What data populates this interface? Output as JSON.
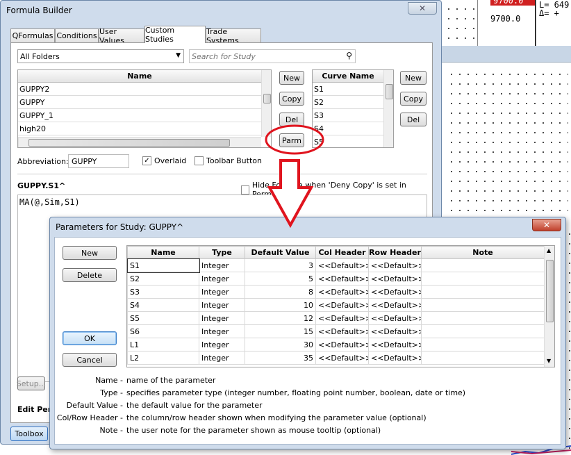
{
  "background_chart": {
    "price_top": "9700.0",
    "price_label": "9700.0",
    "stat_line1": "L= 649",
    "stat_line2": "Δ=   +"
  },
  "formula_builder": {
    "title": "Formula Builder",
    "close_icon": "✕",
    "tabs": [
      {
        "label": "QFormulas"
      },
      {
        "label": "Conditions"
      },
      {
        "label": "User Values"
      },
      {
        "label": "Custom Studies",
        "selected": true
      },
      {
        "label": "Trade Systems"
      }
    ],
    "folder_select": "All Folders",
    "search_placeholder": "Search for Study",
    "studies_header": "Name",
    "studies": [
      "GUPPY2",
      "GUPPY",
      "GUPPY_1",
      "high20"
    ],
    "study_buttons": {
      "new": "New",
      "copy": "Copy",
      "del": "Del",
      "parm": "Parm"
    },
    "curves_header": "Curve Name",
    "curves": [
      "S1",
      "S2",
      "S3",
      "S4",
      "S5"
    ],
    "curve_buttons": {
      "new": "New",
      "copy": "Copy",
      "del": "Del"
    },
    "abbreviation_label": "Abbreviation:",
    "abbreviation_value": "GUPPY",
    "overlaid_label": "Overlaid",
    "overlaid_checked": true,
    "toolbar_button_label": "Toolbar Button",
    "toolbar_button_checked": false,
    "formula_name": "GUPPY.S1^",
    "hide_formula_label": "Hide Formula when 'Deny Copy' is set in Permissions",
    "formula_text": "MA(@,Sim,S1)",
    "setup_button": "Setup...",
    "edit_perm_label": "Edit Permi",
    "toolbox_button": "Toolbox"
  },
  "parameters_dialog": {
    "title": "Parameters for Study: GUPPY^",
    "close_icon": "✕",
    "buttons": {
      "new": "New",
      "delete": "Delete",
      "ok": "OK",
      "cancel": "Cancel"
    },
    "columns": [
      "Name",
      "Type",
      "Default Value",
      "Col Header",
      "Row Header",
      "Note"
    ],
    "rows": [
      {
        "name": "S1",
        "type": "Integer",
        "default": "3",
        "col": "<<Default>>",
        "row": "<<Default>>",
        "note": ""
      },
      {
        "name": "S2",
        "type": "Integer",
        "default": "5",
        "col": "<<Default>>",
        "row": "<<Default>>",
        "note": ""
      },
      {
        "name": "S3",
        "type": "Integer",
        "default": "8",
        "col": "<<Default>>",
        "row": "<<Default>>",
        "note": ""
      },
      {
        "name": "S4",
        "type": "Integer",
        "default": "10",
        "col": "<<Default>>",
        "row": "<<Default>>",
        "note": ""
      },
      {
        "name": "S5",
        "type": "Integer",
        "default": "12",
        "col": "<<Default>>",
        "row": "<<Default>>",
        "note": ""
      },
      {
        "name": "S6",
        "type": "Integer",
        "default": "15",
        "col": "<<Default>>",
        "row": "<<Default>>",
        "note": ""
      },
      {
        "name": "L1",
        "type": "Integer",
        "default": "30",
        "col": "<<Default>>",
        "row": "<<Default>>",
        "note": ""
      },
      {
        "name": "L2",
        "type": "Integer",
        "default": "35",
        "col": "<<Default>>",
        "row": "<<Default>>",
        "note": ""
      }
    ],
    "descriptions": [
      {
        "term": "Name -",
        "text": "name of the parameter"
      },
      {
        "term": "Type -",
        "text": "specifies parameter type (integer number, floating point number, boolean, date or time)"
      },
      {
        "term": "Default Value -",
        "text": "the default value for the parameter"
      },
      {
        "term": "Col/Row Header -",
        "text": "the column/row header shown when modifying the parameter value (optional)"
      },
      {
        "term": "Note -",
        "text": "the user note for the parameter shown as mouse tooltip (optional)"
      }
    ]
  },
  "annotation_color": "#e0141e"
}
